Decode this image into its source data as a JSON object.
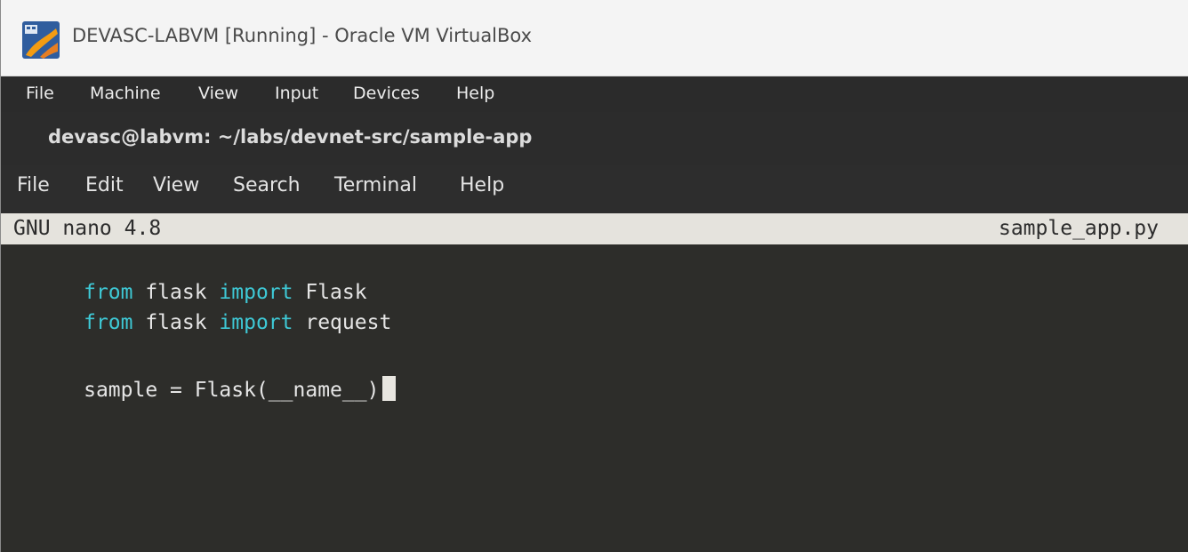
{
  "window": {
    "title": "DEVASC-LABVM [Running] - Oracle VM VirtualBox",
    "logo_icon": "virtualbox-logo-icon"
  },
  "vbox_menu": {
    "items": [
      "File",
      "Machine",
      "View",
      "Input",
      "Devices",
      "Help"
    ]
  },
  "terminal": {
    "title": "devasc@labvm: ~/labs/devnet-src/sample-app",
    "menu": [
      "File",
      "Edit",
      "View",
      "Search",
      "Terminal",
      "Help"
    ]
  },
  "nano": {
    "version_label": "GNU nano 4.8",
    "filename": "sample_app.py",
    "lines": [
      [
        {
          "t": "from",
          "k": "kw"
        },
        {
          "t": " flask ",
          "k": "plain"
        },
        {
          "t": "import",
          "k": "kw"
        },
        {
          "t": " Flask",
          "k": "plain"
        }
      ],
      [
        {
          "t": "from",
          "k": "kw"
        },
        {
          "t": " flask ",
          "k": "plain"
        },
        {
          "t": "import",
          "k": "kw"
        },
        {
          "t": " request",
          "k": "plain"
        }
      ],
      [],
      [
        {
          "t": "sample = Flask(__name__)",
          "k": "plain"
        }
      ]
    ]
  },
  "colors": {
    "keyword": "#3ec9d6",
    "text": "#e6e6e6",
    "editor_bg": "#2d2d2a",
    "nano_bar_bg": "#e5e3dd"
  }
}
